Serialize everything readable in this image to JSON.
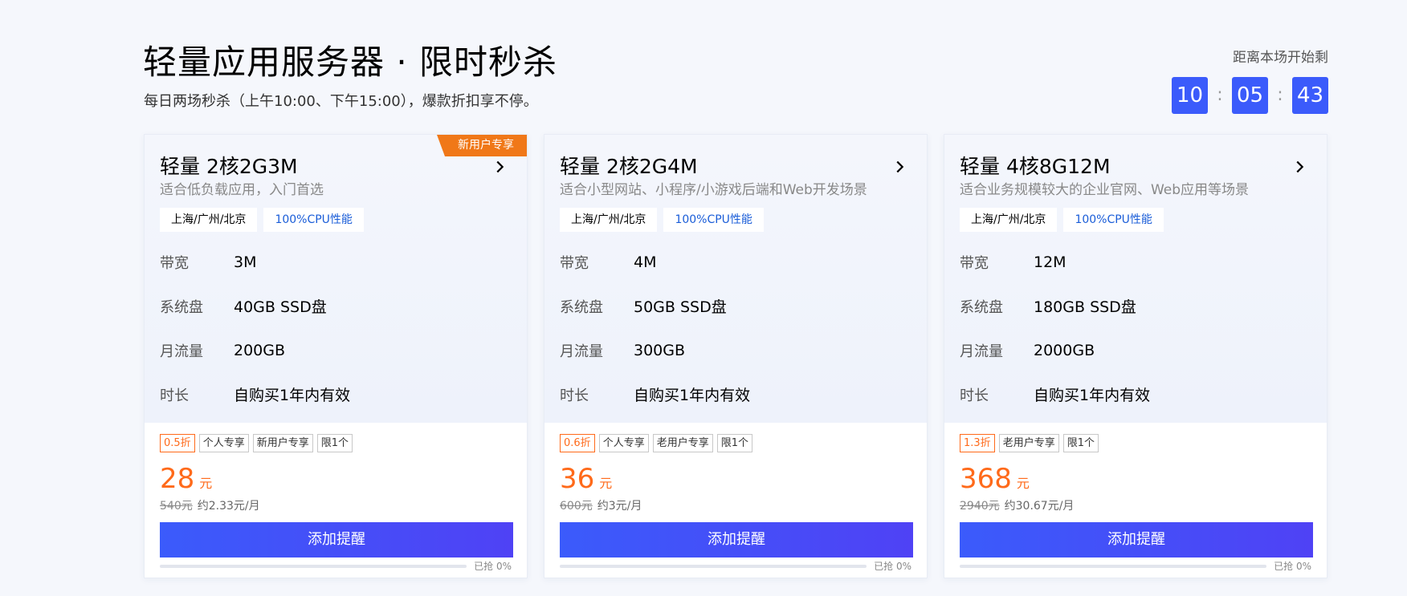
{
  "header": {
    "title": "轻量应用服务器 · 限时秒杀",
    "subtitle": "每日两场秒杀（上午10:00、下午15:00），爆款折扣享不停。",
    "countdown_label": "距离本场开始剩",
    "countdown": {
      "hours": "10",
      "minutes": "05",
      "seconds": "43",
      "separator": ":"
    }
  },
  "cards": [
    {
      "ribbon": "新用户专享",
      "title": "轻量 2核2G3M",
      "desc": "适合低负载应用，入门首选",
      "tags": [
        "上海/广州/北京",
        "100%CPU性能"
      ],
      "specs": [
        {
          "label": "带宽",
          "value": "3M"
        },
        {
          "label": "系统盘",
          "value": "40GB SSD盘"
        },
        {
          "label": "月流量",
          "value": "200GB"
        },
        {
          "label": "时长",
          "value": "自购买1年内有效"
        }
      ],
      "badges": [
        "0.5折",
        "个人专享",
        "新用户专享",
        "限1个"
      ],
      "price": "28",
      "price_unit": "元",
      "original_price": "540元",
      "monthly": "约2.33元/月",
      "button": "添加提醒",
      "sold_text": "已抢 0%",
      "sold_fraction": 0
    },
    {
      "ribbon": "",
      "title": "轻量 2核2G4M",
      "desc": "适合小型网站、小程序/小游戏后端和Web开发场景",
      "tags": [
        "上海/广州/北京",
        "100%CPU性能"
      ],
      "specs": [
        {
          "label": "带宽",
          "value": "4M"
        },
        {
          "label": "系统盘",
          "value": "50GB SSD盘"
        },
        {
          "label": "月流量",
          "value": "300GB"
        },
        {
          "label": "时长",
          "value": "自购买1年内有效"
        }
      ],
      "badges": [
        "0.6折",
        "个人专享",
        "老用户专享",
        "限1个"
      ],
      "price": "36",
      "price_unit": "元",
      "original_price": "600元",
      "monthly": "约3元/月",
      "button": "添加提醒",
      "sold_text": "已抢 0%",
      "sold_fraction": 0
    },
    {
      "ribbon": "",
      "title": "轻量 4核8G12M",
      "desc": "适合业务规模较大的企业官网、Web应用等场景",
      "tags": [
        "上海/广州/北京",
        "100%CPU性能"
      ],
      "specs": [
        {
          "label": "带宽",
          "value": "12M"
        },
        {
          "label": "系统盘",
          "value": "180GB SSD盘"
        },
        {
          "label": "月流量",
          "value": "2000GB"
        },
        {
          "label": "时长",
          "value": "自购买1年内有效"
        }
      ],
      "badges": [
        "1.3折",
        "老用户专享",
        "限1个"
      ],
      "price": "368",
      "price_unit": "元",
      "original_price": "2940元",
      "monthly": "约30.67元/月",
      "button": "添加提醒",
      "sold_text": "已抢 0%",
      "sold_fraction": 0
    }
  ],
  "colors": {
    "accent": "#3b5bfb",
    "price": "#ff6a1a",
    "ribbon": "#f07818",
    "tag_blue": "#1a5dd8"
  },
  "icons": {
    "card_arrow": "chevron-right-icon"
  }
}
